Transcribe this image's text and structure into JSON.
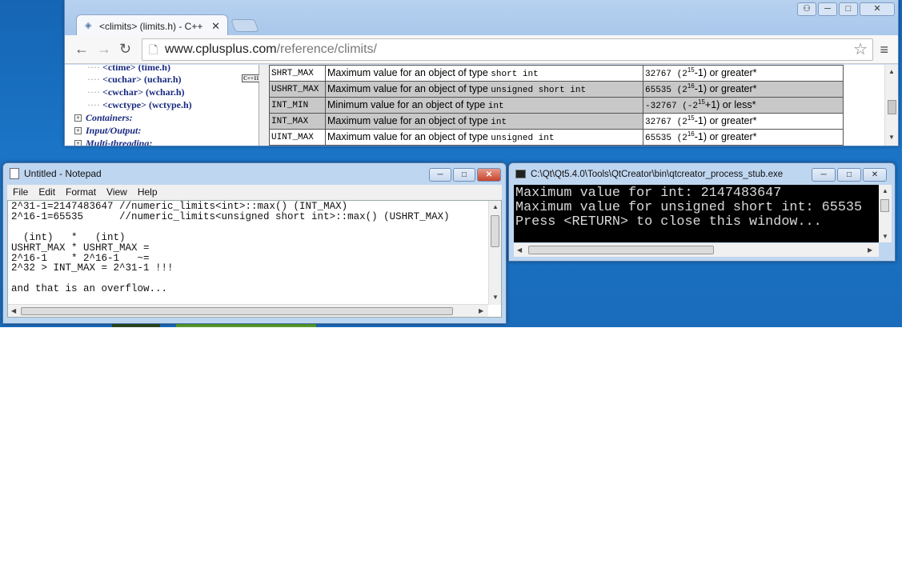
{
  "browser": {
    "tab_title": "<climits> (limits.h) - C++",
    "tab_close": "✕",
    "nav": {
      "back": "←",
      "forward": "→",
      "reload": "↻"
    },
    "url_domain": "www.cplusplus.com",
    "url_path": "/reference/climits/",
    "star": "☆",
    "menu": "≡",
    "sidebar": {
      "items": [
        "<ctime> (time.h)",
        "<cuchar> (uchar.h)",
        "<cwchar> (wchar.h)",
        "<cwctype> (wctype.h)"
      ],
      "sections": [
        "Containers:",
        "Input/Output:",
        "Multi-threading:"
      ],
      "badge": "C++11"
    },
    "table": [
      {
        "name": "SHRT_MAX",
        "desc": "Maximum value for an object of type ",
        "type": "short int",
        "val_base": "32767 (2",
        "val_exp": "15",
        "val_rest": "-1) or greater*"
      },
      {
        "name": "USHRT_MAX",
        "desc": "Maximum value for an object of type ",
        "type": "unsigned short int",
        "val_base": "65535 (2",
        "val_exp": "16",
        "val_rest": "-1) or greater*"
      },
      {
        "name": "INT_MIN",
        "desc": "Minimum value for an object of type ",
        "type": "int",
        "val_base": "-32767 (-2",
        "val_exp": "15",
        "val_rest": "+1) or less*"
      },
      {
        "name": "INT_MAX",
        "desc": "Maximum value for an object of type ",
        "type": "int",
        "val_base": "32767 (2",
        "val_exp": "15",
        "val_rest": "-1) or greater*"
      },
      {
        "name": "UINT_MAX",
        "desc": "Maximum value for an object of type ",
        "type": "unsigned int",
        "val_base": "65535 (2",
        "val_exp": "16",
        "val_rest": "-1) or greater*"
      }
    ]
  },
  "notepad": {
    "title": "Untitled - Notepad",
    "menu": [
      "File",
      "Edit",
      "Format",
      "View",
      "Help"
    ],
    "content": "2^31-1=2147483647 //numeric_limits<int>::max() (INT_MAX)\n2^16-1=65535      //numeric_limits<unsigned short int>::max() (USHRT_MAX)\n\n  (int)   *   (int)\nUSHRT_MAX * USHRT_MAX =\n2^16-1    * 2^16-1   ~=\n2^32 > INT_MAX = 2^31-1 !!!\n\nand that is an overflow..."
  },
  "console": {
    "title": "C:\\Qt\\Qt5.4.0\\Tools\\QtCreator\\bin\\qtcreator_process_stub.exe",
    "output": "Maximum value for int: 2147483647\nMaximum value for unsigned short int: 65535\nPress <RETURN> to close this window..."
  },
  "window_buttons": {
    "minimize": "─",
    "maximize": "□",
    "close": "✕",
    "user": "👤"
  }
}
